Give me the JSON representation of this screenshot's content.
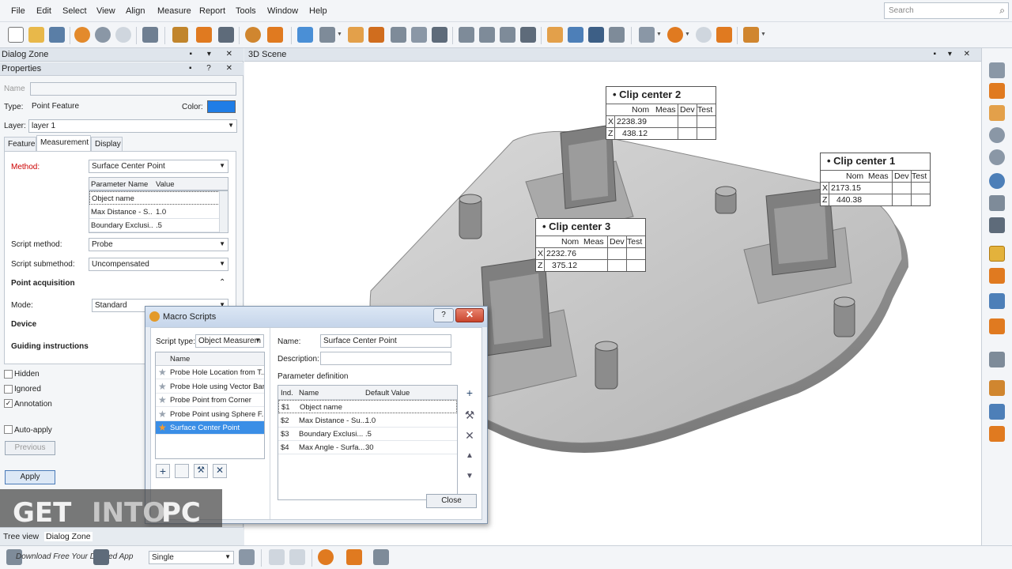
{
  "menu": [
    "File",
    "Edit",
    "Select",
    "View",
    "Align",
    "Measure",
    "Report",
    "Tools",
    "Window",
    "Help"
  ],
  "search": {
    "placeholder": "Search",
    "icon": "search-icon"
  },
  "dialog_zone": {
    "title": "Dialog Zone"
  },
  "properties": {
    "title": "Properties",
    "name_label": "Name",
    "name_value": "",
    "type_label": "Type:",
    "type_value": "Point Feature",
    "color_label": "Color:",
    "color_value": "#1f7de6",
    "layer_label": "Layer:",
    "layer_value": "layer 1",
    "tabs": [
      "Feature",
      "Measurement",
      "Display"
    ],
    "active_tab": "Measurement",
    "method_label": "Method:",
    "method_value": "Surface Center Point",
    "param_headers": [
      "Parameter Name",
      "Value"
    ],
    "params": [
      {
        "name": "Object name",
        "value": ""
      },
      {
        "name": "Max Distance - S...",
        "value": "1.0"
      },
      {
        "name": "Boundary Exclusi...",
        "value": ".5"
      }
    ],
    "script_method_label": "Script method:",
    "script_method_value": "Probe",
    "script_submethod_label": "Script submethod:",
    "script_submethod_value": "Uncompensated",
    "point_acquisition": "Point acquisition",
    "mode_label": "Mode:",
    "mode_value": "Standard",
    "device_label": "Device",
    "guiding_label": "Guiding instructions",
    "hidden_label": "Hidden",
    "ignored_label": "Ignored",
    "annotation_label": "Annotation",
    "autoapply_label": "Auto-apply",
    "previous_label": "Previous",
    "apply_label": "Apply"
  },
  "scene": {
    "title": "3D Scene",
    "labels": [
      {
        "title": "Clip center 2",
        "headers": [
          "Nom",
          "Meas",
          "Dev",
          "Test"
        ],
        "rows": [
          {
            "axis": "X",
            "meas": "2238.39"
          },
          {
            "axis": "Z",
            "meas": "438.12"
          }
        ]
      },
      {
        "title": "Clip center 1",
        "headers": [
          "Nom",
          "Meas",
          "Dev",
          "Test"
        ],
        "rows": [
          {
            "axis": "X",
            "meas": "2173.15"
          },
          {
            "axis": "Z",
            "meas": "440.38"
          }
        ]
      },
      {
        "title": "Clip center 3",
        "headers": [
          "Nom",
          "Meas",
          "Dev",
          "Test"
        ],
        "rows": [
          {
            "axis": "X",
            "meas": "2232.76"
          },
          {
            "axis": "Z",
            "meas": "375.12"
          }
        ]
      }
    ]
  },
  "macro": {
    "title": "Macro Scripts",
    "help": "?",
    "close_x": "✕",
    "script_type_label": "Script type:",
    "script_type_value": "Object Measurem",
    "list_header": "Name",
    "items": [
      "Probe Hole Location from T...",
      "Probe Hole using Vector Bar",
      "Probe Point from Corner",
      "Probe Point using Sphere F...",
      "Surface Center Point"
    ],
    "selected": 4,
    "name_label": "Name:",
    "name_value": "Surface Center Point",
    "description_label": "Description:",
    "description_value": "",
    "param_def_label": "Parameter definition",
    "table_headers": [
      "Ind.",
      "Name",
      "Default Value"
    ],
    "rows": [
      {
        "ind": "$1",
        "name": "Object name",
        "value": ""
      },
      {
        "ind": "$2",
        "name": "Max Distance - Su...",
        "value": "1.0"
      },
      {
        "ind": "$3",
        "name": "Boundary Exclusi...",
        "value": ".5"
      },
      {
        "ind": "$4",
        "name": "Max Angle - Surfa...",
        "value": "30"
      }
    ],
    "close_label": "Close"
  },
  "bottom": {
    "tree_view": "Tree view",
    "dialog_zone": "Dialog Zone",
    "single_value": "Single",
    "watermark_1": "GET",
    "watermark_2": "INTO",
    "watermark_3": "PC",
    "watermark_sub": "Download Free Your Desired App"
  }
}
